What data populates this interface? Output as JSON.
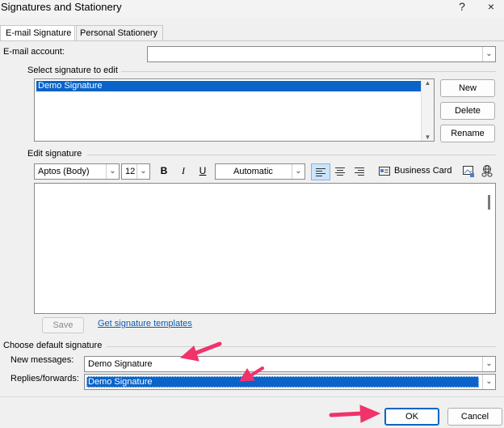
{
  "window": {
    "title": "Signatures and Stationery",
    "help": "?",
    "close": "×"
  },
  "tabs": [
    {
      "label": "E-mail Signature",
      "active": true
    },
    {
      "label": "Personal Stationery",
      "active": false
    }
  ],
  "email_account": {
    "label": "E-mail account:",
    "value": ""
  },
  "select_signature": {
    "group_label": "Select signature to edit",
    "items": [
      "Demo Signature"
    ],
    "selected": "Demo Signature",
    "buttons": {
      "new": "New",
      "delete": "Delete",
      "rename": "Rename"
    }
  },
  "edit_signature": {
    "group_label": "Edit signature",
    "font": "Aptos (Body)",
    "size": "12",
    "bold": "B",
    "italic": "I",
    "underline": "U",
    "color": "Automatic",
    "business_card": "Business Card",
    "body_text": "",
    "save": "Save",
    "templates_link": "Get signature templates"
  },
  "default_signature": {
    "group_label": "Choose default signature",
    "new_messages_label": "New messages:",
    "new_messages_value": "Demo Signature",
    "replies_label": "Replies/forwards:",
    "replies_value": "Demo Signature"
  },
  "footer": {
    "ok": "OK",
    "cancel": "Cancel"
  },
  "colors": {
    "selection": "#0a63c9",
    "link": "#0b5cad",
    "annotation_arrow": "#f0336b"
  }
}
